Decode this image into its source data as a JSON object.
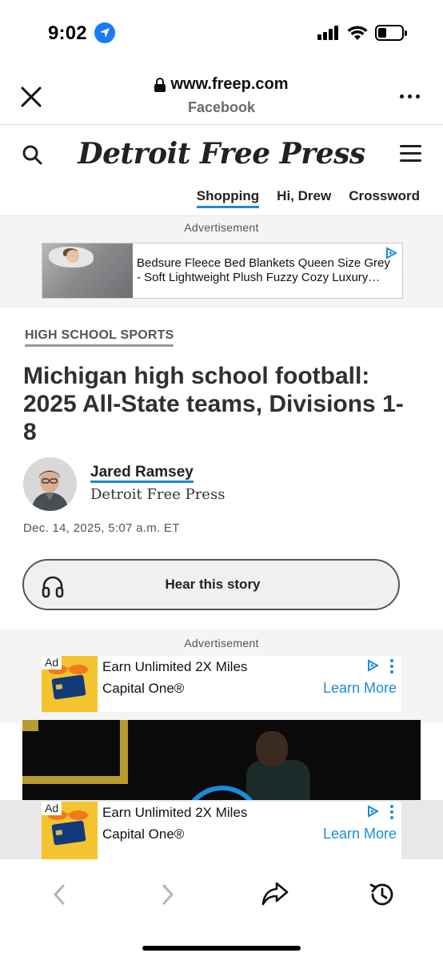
{
  "status": {
    "time": "9:02"
  },
  "browser": {
    "url": "www.freep.com",
    "source": "Facebook"
  },
  "site": {
    "masthead": "Detroit Free Press",
    "nav": [
      "Shopping",
      "Hi, Drew",
      "Crossword"
    ],
    "accent": "#1a8cd8"
  },
  "ad1": {
    "label": "Advertisement",
    "line1": "Bedsure Fleece Bed Blankets Queen Size Grey",
    "line2": "- Soft Lightweight Plush Fuzzy Cozy Luxury…"
  },
  "article": {
    "section": "HIGH SCHOOL SPORTS",
    "headline": "Michigan high school football: 2025 All-State teams, Divisions 1-8",
    "author": "Jared Ramsey",
    "org": "Detroit Free Press",
    "timestamp": "Dec. 14, 2025, 5:07 a.m. ET",
    "hear_label": "Hear this story"
  },
  "ad2": {
    "label": "Advertisement",
    "badge": "Ad",
    "line1": "Earn Unlimited 2X Miles",
    "line2": "Capital One®",
    "cta": "Learn More"
  },
  "ad3": {
    "badge": "Ad",
    "line1": "Earn Unlimited 2X Miles",
    "line2": "Capital One®",
    "cta": "Learn More"
  },
  "icons": {
    "close": "close-icon",
    "lock": "lock-icon",
    "more": "more-icon",
    "search": "search-icon",
    "menu": "hamburger-menu-icon",
    "headphones": "headphones-icon",
    "back": "chevron-left-icon",
    "forward": "chevron-right-icon",
    "share": "share-icon",
    "history": "history-icon"
  }
}
